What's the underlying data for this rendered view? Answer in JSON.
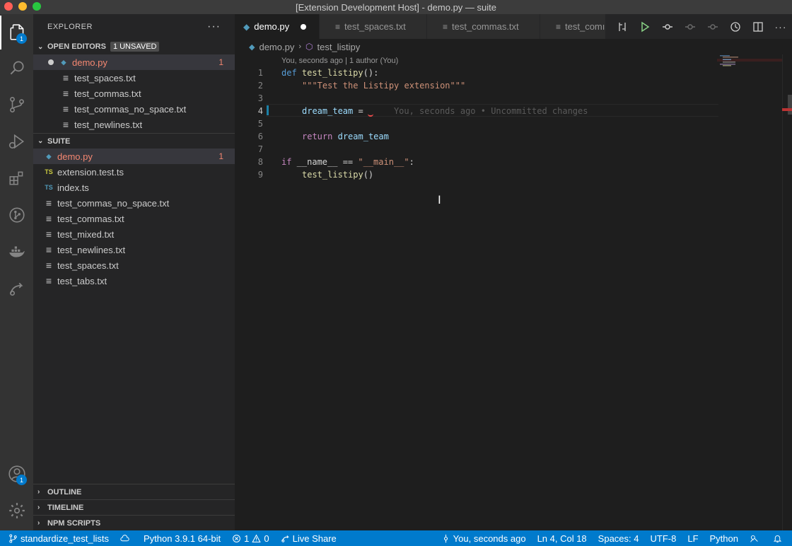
{
  "window": {
    "title": "[Extension Development Host] - demo.py — suite"
  },
  "activity": {
    "explorer_badge": "1",
    "accounts_badge": "1"
  },
  "sidebar": {
    "header": "EXPLORER",
    "more": "···",
    "open_editors": {
      "title": "OPEN EDITORS",
      "pill": "1 UNSAVED",
      "items": [
        {
          "name": "demo.py",
          "count": "1"
        },
        {
          "name": "test_spaces.txt"
        },
        {
          "name": "test_commas.txt"
        },
        {
          "name": "test_commas_no_space.txt"
        },
        {
          "name": "test_newlines.txt"
        }
      ]
    },
    "suite": {
      "title": "SUITE",
      "items": [
        {
          "name": "demo.py",
          "count": "1",
          "icon": "py"
        },
        {
          "name": "extension.test.ts",
          "icon": "TS"
        },
        {
          "name": "index.ts",
          "icon": "TS"
        },
        {
          "name": "test_commas_no_space.txt",
          "icon": "≡"
        },
        {
          "name": "test_commas.txt",
          "icon": "≡"
        },
        {
          "name": "test_mixed.txt",
          "icon": "≡"
        },
        {
          "name": "test_newlines.txt",
          "icon": "≡"
        },
        {
          "name": "test_spaces.txt",
          "icon": "≡"
        },
        {
          "name": "test_tabs.txt",
          "icon": "≡"
        }
      ]
    },
    "bottom": [
      "OUTLINE",
      "TIMELINE",
      "NPM SCRIPTS"
    ]
  },
  "tabs": [
    {
      "label": "demo.py",
      "active": true
    },
    {
      "label": "test_spaces.txt"
    },
    {
      "label": "test_commas.txt"
    },
    {
      "label": "test_comı"
    }
  ],
  "breadcrumb": {
    "file": "demo.py",
    "symbol": "test_listipy"
  },
  "editor": {
    "codelens": "You, seconds ago | 1 author (You)",
    "line_numbers": [
      "1",
      "2",
      "3",
      "4",
      "5",
      "6",
      "7",
      "8",
      "9"
    ],
    "lines": {
      "l1_kw": "def",
      "l1_fn": "test_listipy",
      "l1_rest": "():",
      "l2_str": "\"\"\"Test the Listipy extension\"\"\"",
      "l4_var": "dream_team",
      "l4_rest": " = ",
      "l4_blame": "You, seconds ago • Uncommitted changes",
      "l6_kw": "return",
      "l6_var": "dream_team",
      "l8_kw": "if",
      "l8_a": " __name__ == ",
      "l8_str": "\"__main__\"",
      "l8_b": ":",
      "l9_fn": "test_listipy",
      "l9_rest": "()"
    },
    "cursor_glyph": "I"
  },
  "statusbar": {
    "branch": "standardize_test_lists",
    "python": "Python 3.9.1 64-bit",
    "errors": "1",
    "warnings": "0",
    "liveshare": "Live Share",
    "blame": "You, seconds ago",
    "position": "Ln 4, Col 18",
    "spaces": "Spaces: 4",
    "encoding": "UTF-8",
    "eol": "LF",
    "language": "Python"
  }
}
